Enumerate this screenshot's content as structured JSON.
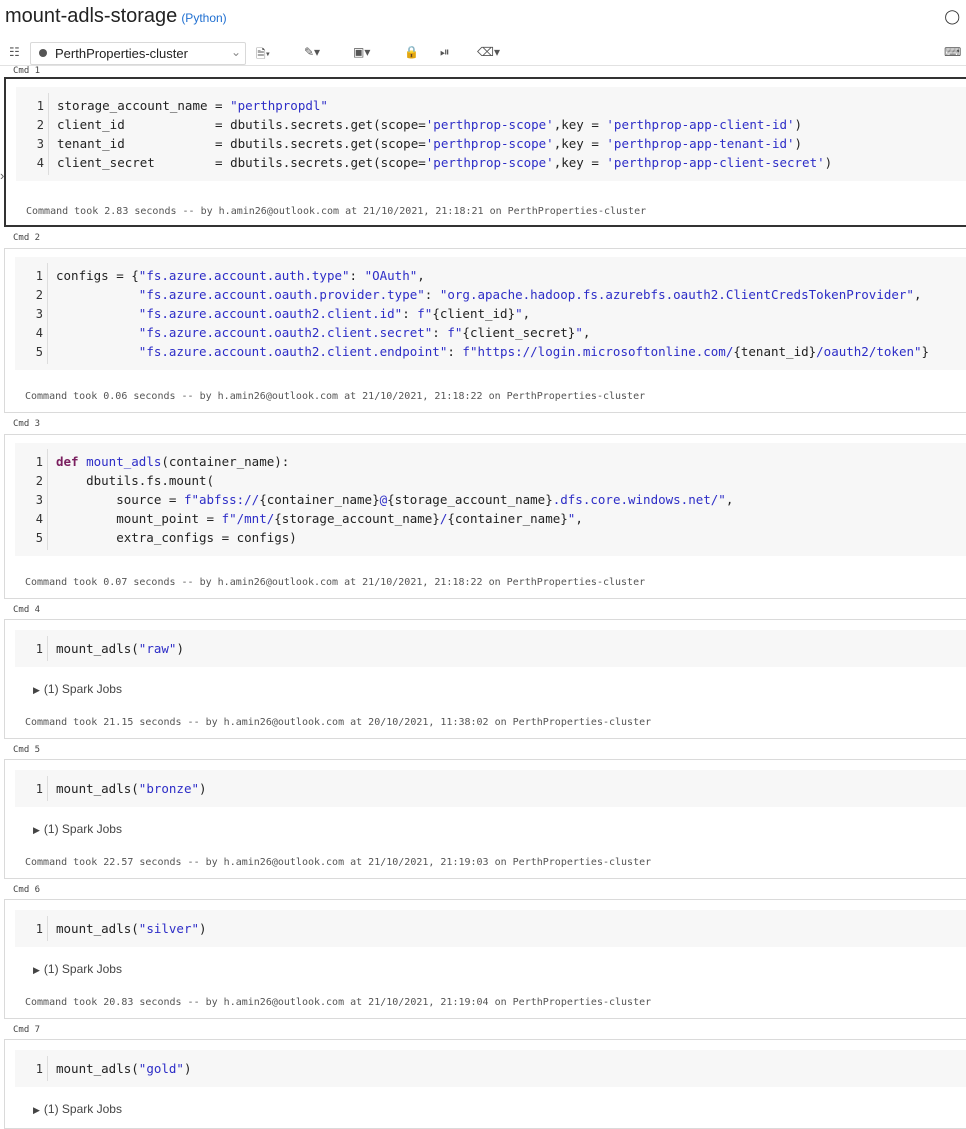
{
  "header": {
    "title": "mount-adls-storage",
    "language": "(Python)"
  },
  "toolbar": {
    "cluster_name": "PerthProperties-cluster"
  },
  "cells": [
    {
      "cmd": "Cmd 1",
      "lines": [
        {
          "n": "1",
          "html": "storage_account_name = <span class=\"str\">\"perthpropdl\"</span>"
        },
        {
          "n": "2",
          "html": "client_id            = dbutils.secrets.get(scope=<span class=\"str\">'perthprop-scope'</span>,key = <span class=\"str\">'perthprop-app-client-id'</span>)"
        },
        {
          "n": "3",
          "html": "tenant_id            = dbutils.secrets.get(scope=<span class=\"str\">'perthprop-scope'</span>,key = <span class=\"str\">'perthprop-app-tenant-id'</span>)"
        },
        {
          "n": "4",
          "html": "client_secret        = dbutils.secrets.get(scope=<span class=\"str\">'perthprop-scope'</span>,key = <span class=\"str\">'perthprop-app-client-secret'</span>)"
        }
      ],
      "spark": "",
      "footer": "Command took 2.83 seconds -- by h.amin26@outlook.com at 21/10/2021, 21:18:21 on PerthProperties-cluster"
    },
    {
      "cmd": "Cmd 2",
      "lines": [
        {
          "n": "1",
          "html": "configs = {<span class=\"str\">\"fs.azure.account.auth.type\"</span>: <span class=\"str\">\"OAuth\"</span>,"
        },
        {
          "n": "2",
          "html": "           <span class=\"str\">\"fs.azure.account.oauth.provider.type\"</span>: <span class=\"str\">\"org.apache.hadoop.fs.azurebfs.oauth2.ClientCredsTokenProvider\"</span>,"
        },
        {
          "n": "3",
          "html": "           <span class=\"str\">\"fs.azure.account.oauth2.client.id\"</span>: <span class=\"str\">f\"</span>{client_id}<span class=\"str\">\"</span>,"
        },
        {
          "n": "4",
          "html": "           <span class=\"str\">\"fs.azure.account.oauth2.client.secret\"</span>: <span class=\"str\">f\"</span>{client_secret}<span class=\"str\">\"</span>,"
        },
        {
          "n": "5",
          "html": "           <span class=\"str\">\"fs.azure.account.oauth2.client.endpoint\"</span>: <span class=\"str\">f\"https://login.microsoftonline.com/</span>{tenant_id}<span class=\"str\">/oauth2/token\"</span>}"
        }
      ],
      "spark": "",
      "footer": "Command took 0.06 seconds -- by h.amin26@outlook.com at 21/10/2021, 21:18:22 on PerthProperties-cluster"
    },
    {
      "cmd": "Cmd 3",
      "lines": [
        {
          "n": "1",
          "html": "<span class=\"kw\">def</span> <span class=\"fn\">mount_adls</span>(container_name):"
        },
        {
          "n": "2",
          "html": "    dbutils.fs.mount("
        },
        {
          "n": "3",
          "html": "        source = <span class=\"str\">f\"abfss://</span>{container_name}<span class=\"str\">@</span>{storage_account_name}<span class=\"str\">.dfs.core.windows.net/\"</span>,"
        },
        {
          "n": "4",
          "html": "        mount_point = <span class=\"str\">f\"/mnt/</span>{storage_account_name}<span class=\"str\">/</span>{container_name}<span class=\"str\">\"</span>,"
        },
        {
          "n": "5",
          "html": "        extra_configs = configs)"
        }
      ],
      "spark": "",
      "footer": "Command took 0.07 seconds -- by h.amin26@outlook.com at 21/10/2021, 21:18:22 on PerthProperties-cluster"
    },
    {
      "cmd": "Cmd 4",
      "lines": [
        {
          "n": "1",
          "html": "mount_adls(<span class=\"str\">\"raw\"</span>)"
        }
      ],
      "spark": "(1) Spark Jobs",
      "footer": "Command took 21.15 seconds -- by h.amin26@outlook.com at 20/10/2021, 11:38:02 on PerthProperties-cluster"
    },
    {
      "cmd": "Cmd 5",
      "lines": [
        {
          "n": "1",
          "html": "mount_adls(<span class=\"str\">\"bronze\"</span>)"
        }
      ],
      "spark": "(1) Spark Jobs",
      "footer": "Command took 22.57 seconds -- by h.amin26@outlook.com at 21/10/2021, 21:19:03 on PerthProperties-cluster"
    },
    {
      "cmd": "Cmd 6",
      "lines": [
        {
          "n": "1",
          "html": "mount_adls(<span class=\"str\">\"silver\"</span>)"
        }
      ],
      "spark": "(1) Spark Jobs",
      "footer": "Command took 20.83 seconds -- by h.amin26@outlook.com at 21/10/2021, 21:19:04 on PerthProperties-cluster"
    },
    {
      "cmd": "Cmd 7",
      "lines": [
        {
          "n": "1",
          "html": "mount_adls(<span class=\"str\">\"gold\"</span>)"
        }
      ],
      "spark": "(1) Spark Jobs",
      "footer": ""
    }
  ]
}
